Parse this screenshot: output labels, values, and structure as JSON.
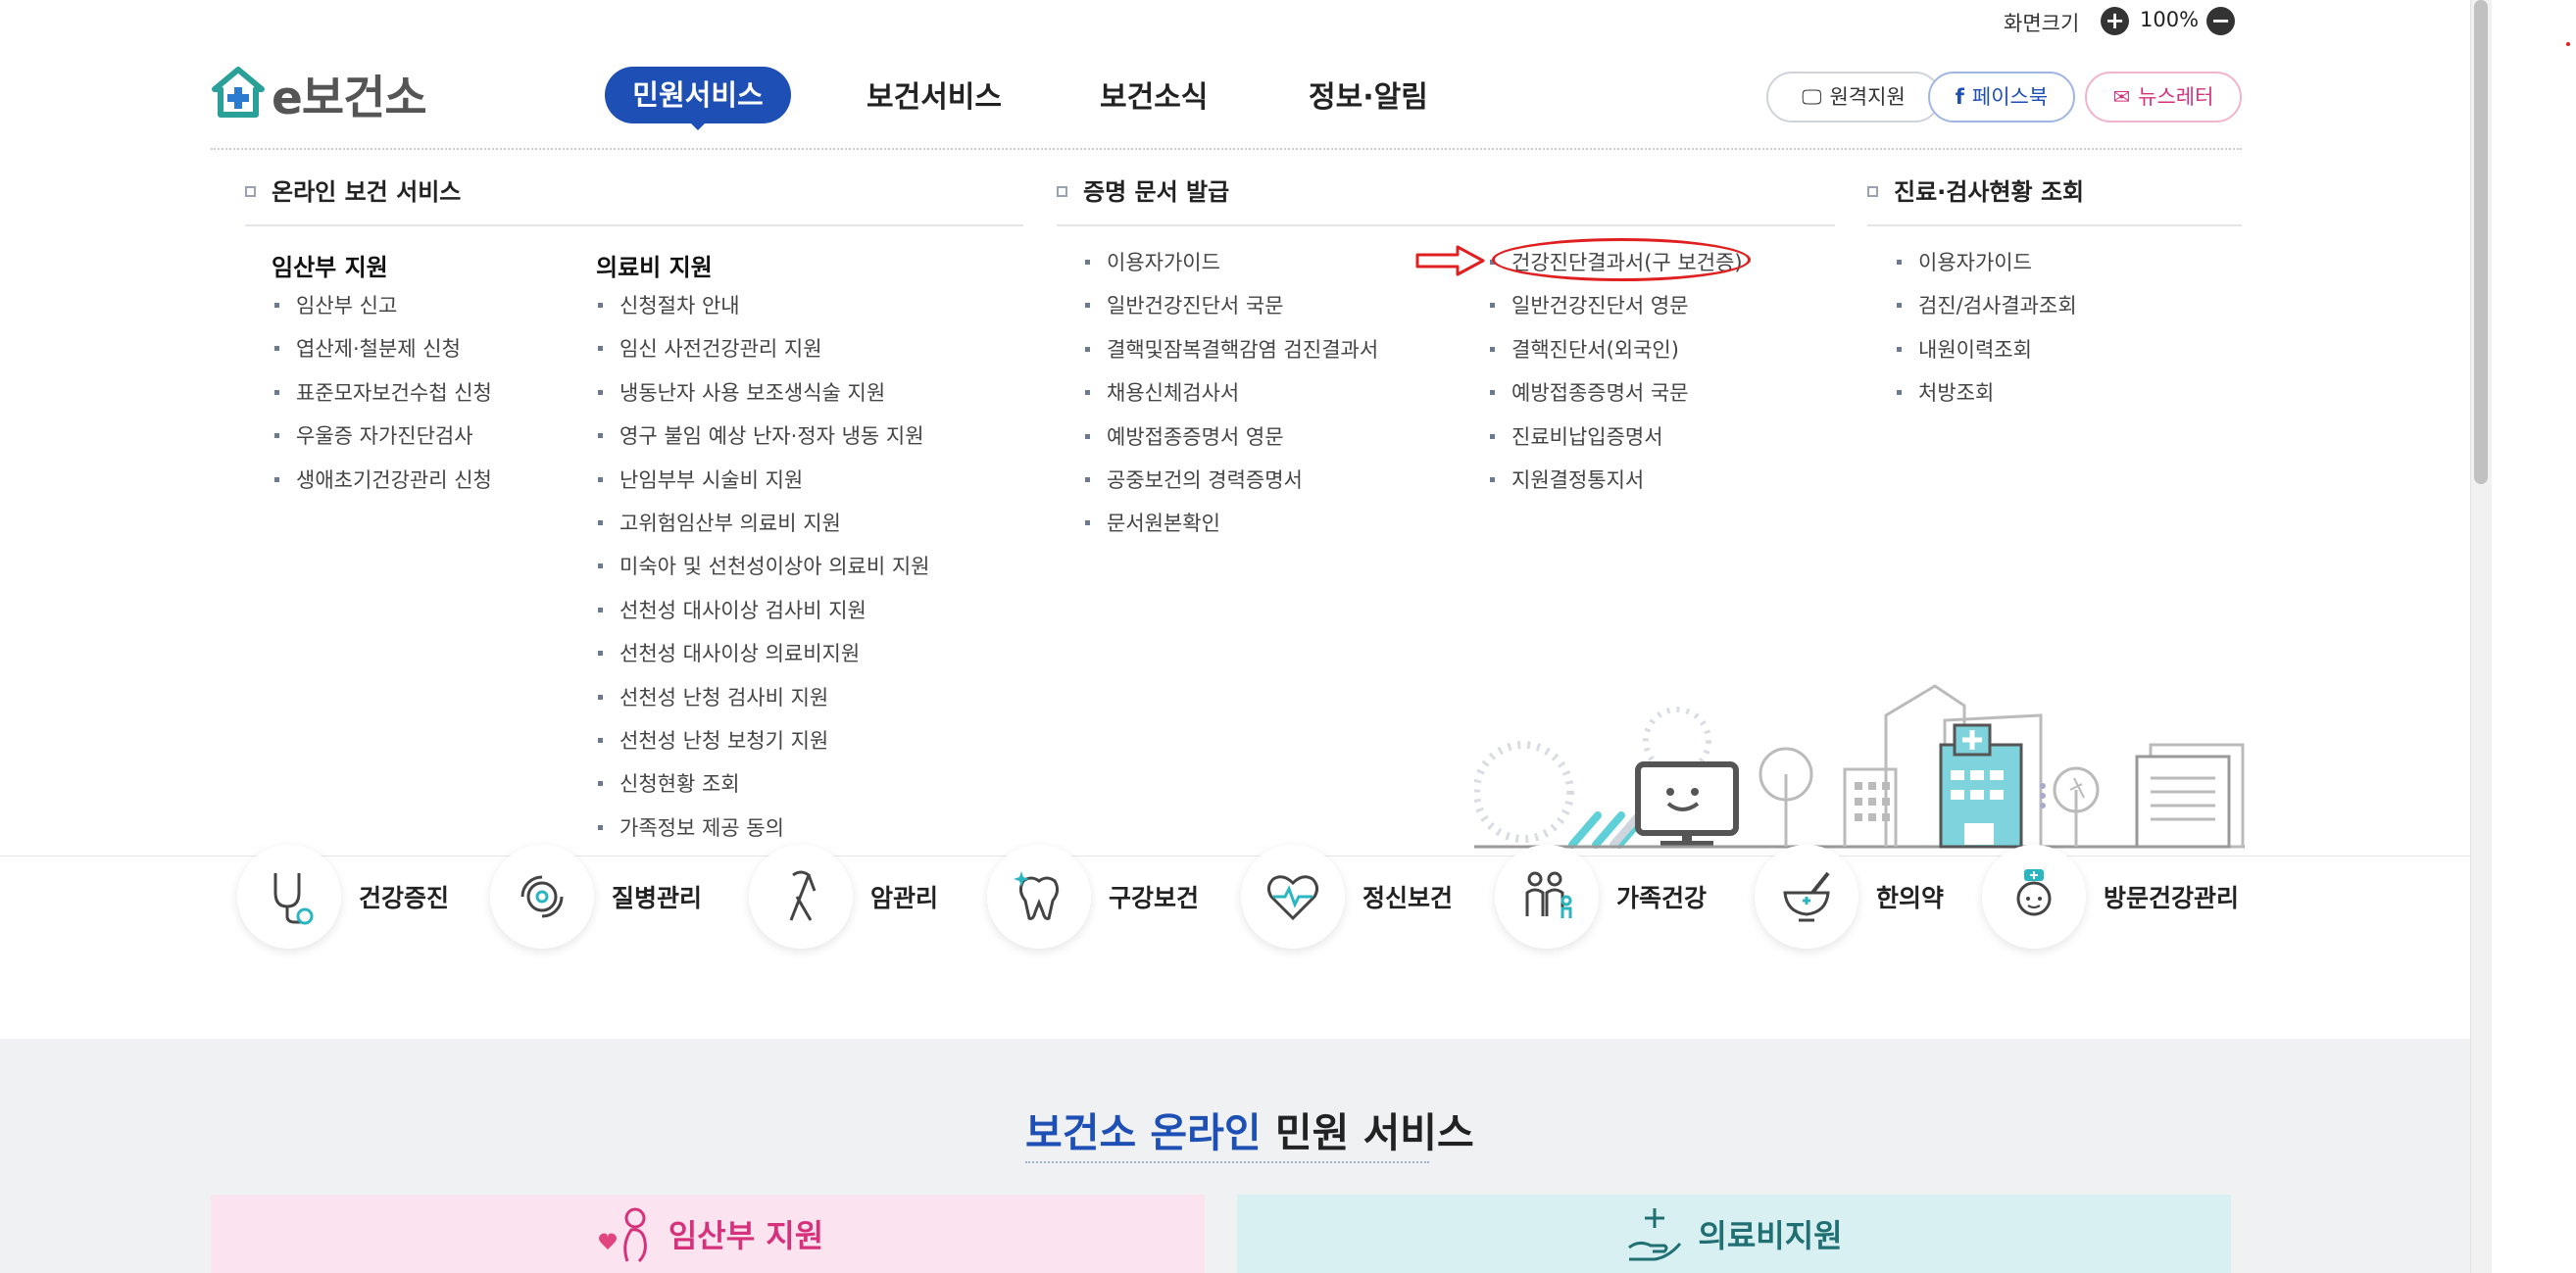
{
  "topbar": {
    "zoom_label": "화면크기",
    "zoom_plus": "+",
    "zoom_minus": "−",
    "zoom_value": "100%"
  },
  "logo": {
    "text": "e보건소"
  },
  "nav": {
    "items": [
      "민원서비스",
      "보건서비스",
      "보건소식",
      "정보·알림"
    ],
    "active": "민원서비스"
  },
  "header_buttons": {
    "remote": "원격지원",
    "facebook": "페이스북",
    "newsletter": "뉴스레터"
  },
  "menu": {
    "online": {
      "title": "온라인 보건 서비스",
      "pregnant": {
        "title": "임산부 지원",
        "items": [
          "임산부 신고",
          "엽산제·철분제 신청",
          "표준모자보건수첩 신청",
          "우울증 자가진단검사",
          "생애초기건강관리 신청"
        ]
      },
      "medical": {
        "title": "의료비 지원",
        "items": [
          "신청절차 안내",
          "임신 사전건강관리 지원",
          "냉동난자 사용 보조생식술 지원",
          "영구 불임 예상 난자·정자 냉동 지원",
          "난임부부 시술비 지원",
          "고위험임산부 의료비 지원",
          "미숙아 및 선천성이상아 의료비 지원",
          "선천성 대사이상 검사비 지원",
          "선천성 대사이상 의료비지원",
          "선천성 난청 검사비 지원",
          "선천성 난청 보청기 지원",
          "신청현황 조회",
          "가족정보 제공 동의"
        ]
      }
    },
    "certificate": {
      "title": "증명 문서 발급",
      "col1": [
        "이용자가이드",
        "일반건강진단서 국문",
        "결핵및잠복결핵감염 검진결과서",
        "채용신체검사서",
        "예방접종증명서 영문",
        "공중보건의 경력증명서",
        "문서원본확인"
      ],
      "col2": [
        "건강진단결과서(구 보건증)",
        "일반건강진단서 영문",
        "결핵진단서(외국인)",
        "예방접종증명서 국문",
        "진료비납입증명서",
        "지원결정통지서"
      ]
    },
    "inquiry": {
      "title": "진료·검사현황 조회",
      "items": [
        "이용자가이드",
        "검진/검사결과조회",
        "내원이력조회",
        "처방조회"
      ]
    }
  },
  "categories": [
    "건강증진",
    "질병관리",
    "암관리",
    "구강보건",
    "정신보건",
    "가족건강",
    "한의약",
    "방문건강관리"
  ],
  "section": {
    "title_highlight": "보건소 온라인",
    "title_rest": " 민원 서비스"
  },
  "cards": {
    "pregnant": "임산부 지원",
    "medical": "의료비지원"
  },
  "colors": {
    "brand_blue": "#1e4fb4",
    "annotation_red": "#e02020",
    "pink_card": "#fbe3ef",
    "teal_card": "#d8f0f1"
  },
  "icons": [
    "plus-icon",
    "minus-icon",
    "monitor-icon",
    "facebook-icon",
    "mail-icon",
    "stethoscope-icon",
    "virus-icon",
    "ribbon-icon",
    "tooth-icon",
    "heartbeat-icon",
    "family-icon",
    "mortar-icon",
    "nurse-icon",
    "arrow-icon"
  ]
}
